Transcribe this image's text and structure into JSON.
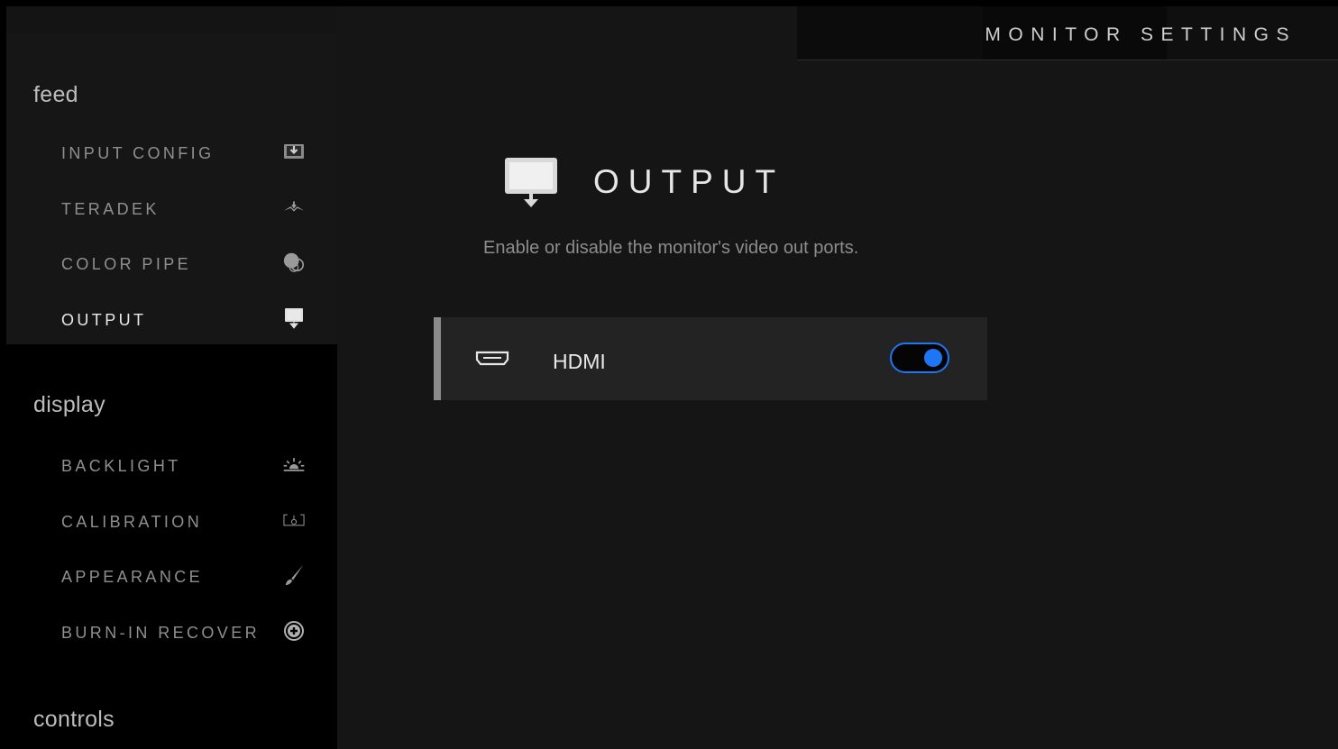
{
  "header": {
    "title": "MONITOR SETTINGS"
  },
  "sidebar": {
    "groups": [
      {
        "title": "feed",
        "items": [
          {
            "label": "INPUT CONFIG",
            "icon": "input-config-icon"
          },
          {
            "label": "TERADEK",
            "icon": "teradek-icon"
          },
          {
            "label": "COLOR PIPE",
            "icon": "color-pipe-icon"
          },
          {
            "label": "OUTPUT",
            "icon": "output-icon",
            "selected": true
          }
        ]
      },
      {
        "title": "display",
        "items": [
          {
            "label": "BACKLIGHT",
            "icon": "backlight-icon"
          },
          {
            "label": "CALIBRATION",
            "icon": "calibration-icon"
          },
          {
            "label": "APPEARANCE",
            "icon": "brush-icon"
          },
          {
            "label": "BURN-IN RECOVER",
            "icon": "plus-circle-icon"
          }
        ]
      },
      {
        "title": "controls",
        "items": []
      }
    ]
  },
  "main": {
    "section_title": "OUTPUT",
    "section_icon": "output-icon",
    "description": "Enable or disable the monitor's video out ports.",
    "rows": [
      {
        "label": "HDMI",
        "icon": "hdmi-port-icon",
        "enabled": true
      }
    ]
  },
  "colors": {
    "accent": "#1f76f5",
    "background": "#151515",
    "sidebar": "#000000",
    "row_background": "#232323"
  }
}
